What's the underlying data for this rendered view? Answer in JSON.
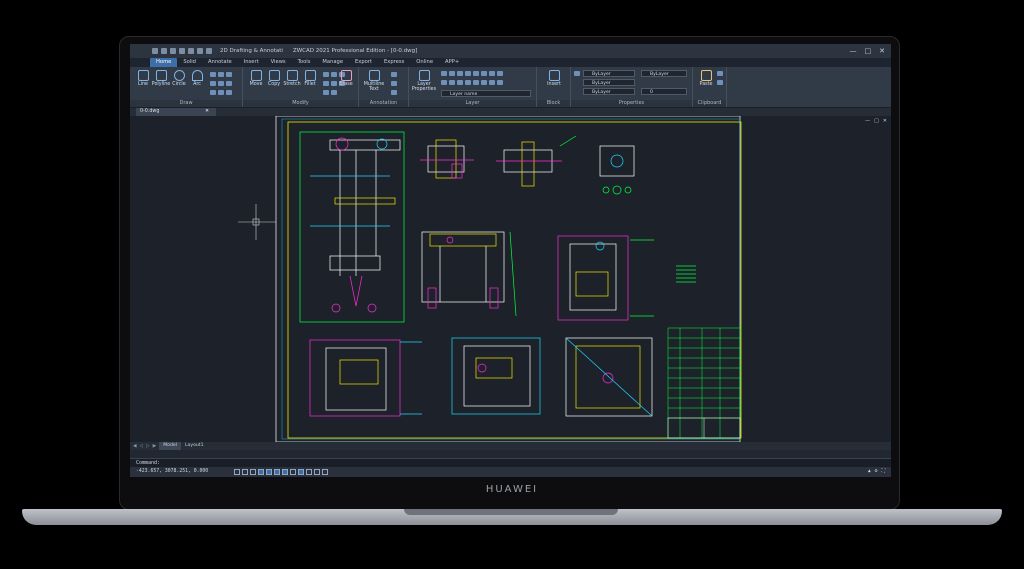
{
  "device": {
    "brand": "HUAWEI"
  },
  "app": {
    "title": "ZWCAD 2021 Professional Edition - [0-0.dwg]",
    "workspace": "2D Drafting & Annotati",
    "window_buttons": [
      "—",
      "□",
      "✕"
    ]
  },
  "tabs": [
    {
      "label": "Home",
      "active": true
    },
    {
      "label": "Solid"
    },
    {
      "label": "Annotate"
    },
    {
      "label": "Insert"
    },
    {
      "label": "Views"
    },
    {
      "label": "Tools"
    },
    {
      "label": "Manage"
    },
    {
      "label": "Export"
    },
    {
      "label": "Express"
    },
    {
      "label": "Online"
    },
    {
      "label": "APP+"
    }
  ],
  "ribbon": {
    "draw": {
      "label": "Draw",
      "tools": [
        "Line",
        "Polyline",
        "Circle",
        "Arc"
      ]
    },
    "modify": {
      "label": "Modify",
      "tools": [
        "Move",
        "Copy",
        "Stretch",
        "Fillet"
      ]
    },
    "erase": "Erase",
    "annotation": {
      "label": "Annotation",
      "tools": [
        "Multiline Text"
      ]
    },
    "layer": {
      "label": "Layer",
      "tools": [
        "Layer Properties"
      ],
      "current_layer": "Layer name"
    },
    "block": {
      "label": "Block",
      "tools": [
        "Insert"
      ]
    },
    "properties": {
      "label": "Properties",
      "color": "ByLayer",
      "linetype": "ByLayer",
      "lineweight": "ByLayer",
      "plotstyle": "ByLayer",
      "transparency": "0"
    },
    "clipboard": {
      "label": "Clipboard",
      "tools": [
        "Paste"
      ]
    }
  },
  "file_tab": {
    "label": "0-0.dwg"
  },
  "layout_tabs": [
    {
      "label": "Model",
      "active": true
    },
    {
      "label": "Layout1"
    }
  ],
  "command": {
    "prompt": "Command:"
  },
  "status": {
    "coords": "-423.657, 3078.251, 0.000"
  },
  "colors": {
    "accent": "#3e6ea8",
    "drawing_bg": "#1d222a",
    "cad_green": "#00ff3c",
    "cad_magenta": "#ff2bd6",
    "cad_yellow": "#f2e600",
    "cad_cyan": "#1fd6ff"
  }
}
